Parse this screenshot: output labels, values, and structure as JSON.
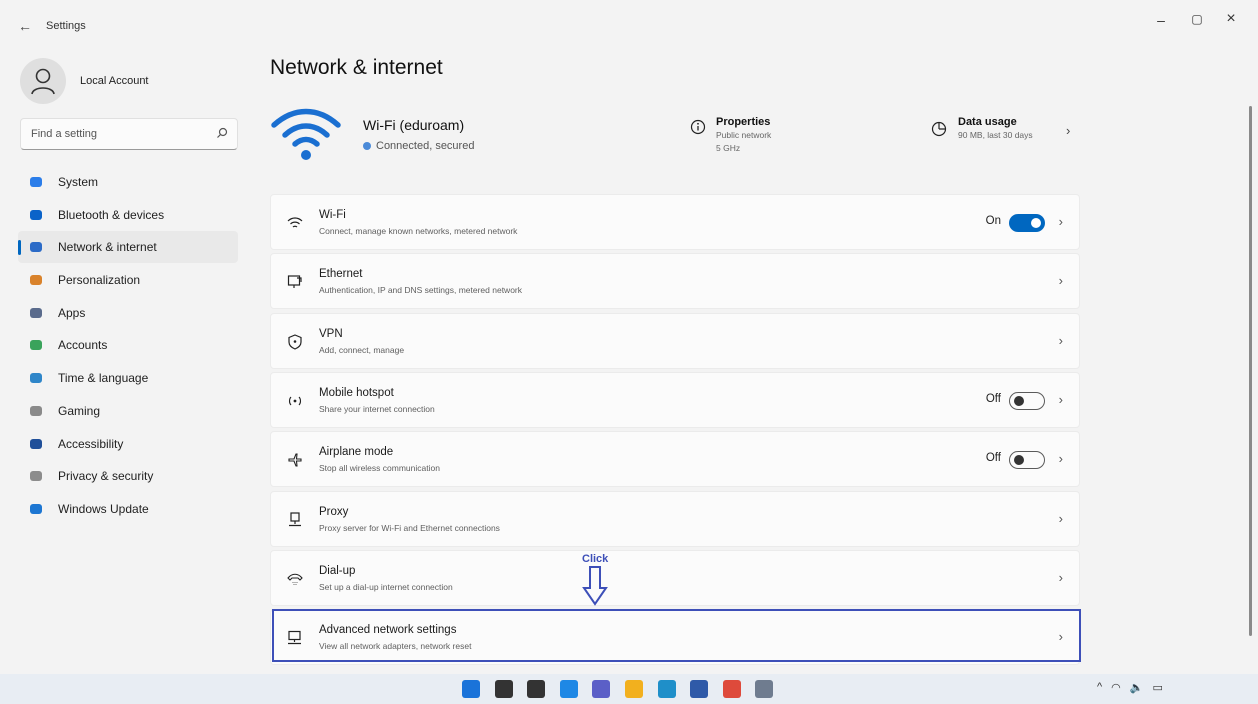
{
  "window": {
    "back_glyph": "←",
    "title": "Settings",
    "minimize": "–",
    "restore": "▢",
    "close": "×"
  },
  "sidebar": {
    "account_name": "Local Account",
    "search_placeholder": "Find a setting",
    "items": [
      {
        "label": "System",
        "icon": "system-icon",
        "color": "#2b7de9"
      },
      {
        "label": "Bluetooth & devices",
        "icon": "bluetooth-icon",
        "color": "#0a63c9"
      },
      {
        "label": "Network & internet",
        "icon": "network-icon",
        "color": "#2c6bc7",
        "active": true
      },
      {
        "label": "Personalization",
        "icon": "brush-icon",
        "color": "#d9822b"
      },
      {
        "label": "Apps",
        "icon": "apps-icon",
        "color": "#5a6b8c"
      },
      {
        "label": "Accounts",
        "icon": "accounts-icon",
        "color": "#3aa35b"
      },
      {
        "label": "Time & language",
        "icon": "globe-icon",
        "color": "#2f86c9"
      },
      {
        "label": "Gaming",
        "icon": "gaming-icon",
        "color": "#8a8a8a"
      },
      {
        "label": "Accessibility",
        "icon": "accessibility-icon",
        "color": "#1f4f99"
      },
      {
        "label": "Privacy & security",
        "icon": "shield-icon",
        "color": "#8c8c8c"
      },
      {
        "label": "Windows Update",
        "icon": "update-icon",
        "color": "#1d76d2"
      }
    ]
  },
  "main": {
    "title": "Network & internet",
    "hero": {
      "network_name": "Wi-Fi (eduroam)",
      "status": "Connected, secured",
      "properties_title": "Properties",
      "properties_line1": "Public network",
      "properties_line2": "5 GHz",
      "usage_title": "Data usage",
      "usage_detail": "90 MB, last 30 days"
    },
    "cards": [
      {
        "title": "Wi-Fi",
        "sub": "Connect, manage known networks, metered network",
        "icon": "wifi-icon",
        "toggle": "On"
      },
      {
        "title": "Ethernet",
        "sub": "Authentication, IP and DNS settings, metered network",
        "icon": "ethernet-icon"
      },
      {
        "title": "VPN",
        "sub": "Add, connect, manage",
        "icon": "vpn-shield-icon"
      },
      {
        "title": "Mobile hotspot",
        "sub": "Share your internet connection",
        "icon": "hotspot-icon",
        "toggle": "Off"
      },
      {
        "title": "Airplane mode",
        "sub": "Stop all wireless communication",
        "icon": "airplane-icon",
        "toggle": "Off"
      },
      {
        "title": "Proxy",
        "sub": "Proxy server for Wi-Fi and Ethernet connections",
        "icon": "proxy-icon"
      },
      {
        "title": "Dial-up",
        "sub": "Set up a dial-up internet connection",
        "icon": "dialup-icon"
      },
      {
        "title": "Advanced network settings",
        "sub": "View all network adapters, network reset",
        "icon": "advanced-network-icon"
      }
    ],
    "annotation": "Click",
    "chevron": "›"
  },
  "taskbar": {
    "apps": [
      {
        "name": "start-icon",
        "color": "#1a73d9"
      },
      {
        "name": "search-icon",
        "color": "#333333"
      },
      {
        "name": "task-view-icon",
        "color": "#333333"
      },
      {
        "name": "widgets-icon",
        "color": "#1e88e5"
      },
      {
        "name": "chat-icon",
        "color": "#5b5fc7"
      },
      {
        "name": "file-explorer-icon",
        "color": "#f2b01e"
      },
      {
        "name": "edge-icon",
        "color": "#1f8fc9"
      },
      {
        "name": "store-icon",
        "color": "#2f5aa8"
      },
      {
        "name": "chrome-icon",
        "color": "#de4a3b"
      },
      {
        "name": "settings-icon",
        "color": "#6f7c8f"
      }
    ],
    "tray": {
      "chevron": "^",
      "wifi": "◠",
      "volume": "🔈",
      "battery": "▭"
    }
  },
  "colors": {
    "accent": "#0067c0",
    "annotation": "#3d4fb8"
  }
}
